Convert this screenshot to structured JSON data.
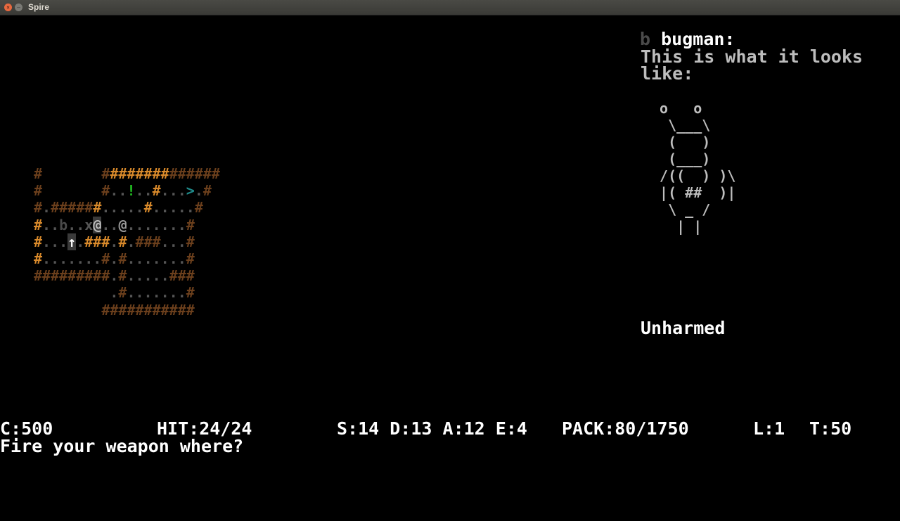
{
  "window": {
    "title": "Spire",
    "close_glyph": "×",
    "min_glyph": "–"
  },
  "map": {
    "rows": [
      [
        {
          "t": "#",
          "c": "#6b3f1c"
        },
        {
          "t": "       ",
          "c": "#000"
        },
        {
          "t": "#",
          "c": "#6b3f1c"
        },
        {
          "t": "#######",
          "c": "#d98a2b"
        },
        {
          "t": "######",
          "c": "#6b3f1c"
        }
      ],
      [
        {
          "t": "#",
          "c": "#6b3f1c"
        },
        {
          "t": "       ",
          "c": "#000"
        },
        {
          "t": "#",
          "c": "#6b3f1c"
        },
        {
          "t": "..",
          "c": "#555"
        },
        {
          "t": "!",
          "c": "#22c022"
        },
        {
          "t": "..",
          "c": "#555"
        },
        {
          "t": "#",
          "c": "#d98a2b"
        },
        {
          "t": "...",
          "c": "#555"
        },
        {
          "t": ">",
          "c": "#1f8a8a"
        },
        {
          "t": ".",
          "c": "#555"
        },
        {
          "t": "#",
          "c": "#6b3f1c"
        }
      ],
      [
        {
          "t": "#",
          "c": "#6b3f1c"
        },
        {
          "t": ".",
          "c": "#555"
        },
        {
          "t": "#####",
          "c": "#6b3f1c"
        },
        {
          "t": "#",
          "c": "#d98a2b"
        },
        {
          "t": ".....",
          "c": "#555"
        },
        {
          "t": "#",
          "c": "#d98a2b"
        },
        {
          "t": ".....",
          "c": "#555"
        },
        {
          "t": "#",
          "c": "#6b3f1c"
        }
      ],
      [
        {
          "t": "#",
          "c": "#d98a2b"
        },
        {
          "t": "..",
          "c": "#555"
        },
        {
          "t": "b",
          "c": "#4a4a4a"
        },
        {
          "t": "..",
          "c": "#555"
        },
        {
          "t": "x",
          "c": "#555"
        },
        {
          "t": "@",
          "c": "#bdbdbd",
          "hl": true
        },
        {
          "t": "..",
          "c": "#555"
        },
        {
          "t": "@",
          "c": "#9a9a9a"
        },
        {
          "t": ".......",
          "c": "#555"
        },
        {
          "t": "#",
          "c": "#6b3f1c"
        }
      ],
      [
        {
          "t": "#",
          "c": "#d98a2b"
        },
        {
          "t": "...",
          "c": "#555"
        },
        {
          "t": "↑",
          "c": "#ffffff",
          "hl": true
        },
        {
          "t": ".",
          "c": "#555"
        },
        {
          "t": "###",
          "c": "#d98a2b"
        },
        {
          "t": ".",
          "c": "#555"
        },
        {
          "t": "#",
          "c": "#d98a2b"
        },
        {
          "t": ".",
          "c": "#555"
        },
        {
          "t": "###",
          "c": "#6b3f1c"
        },
        {
          "t": "...",
          "c": "#555"
        },
        {
          "t": "#",
          "c": "#6b3f1c"
        }
      ],
      [
        {
          "t": "#",
          "c": "#d98a2b"
        },
        {
          "t": ".......",
          "c": "#555"
        },
        {
          "t": "#",
          "c": "#6b3f1c"
        },
        {
          "t": ".",
          "c": "#555"
        },
        {
          "t": "#",
          "c": "#6b3f1c"
        },
        {
          "t": ".......",
          "c": "#555"
        },
        {
          "t": "#",
          "c": "#6b3f1c"
        }
      ],
      [
        {
          "t": "#########",
          "c": "#6b3f1c"
        },
        {
          "t": ".",
          "c": "#555"
        },
        {
          "t": "#",
          "c": "#6b3f1c"
        },
        {
          "t": ".....",
          "c": "#555"
        },
        {
          "t": "###",
          "c": "#6b3f1c"
        }
      ],
      [
        {
          "t": "         ",
          "c": "#000"
        },
        {
          "t": ".",
          "c": "#555"
        },
        {
          "t": "#",
          "c": "#6b3f1c"
        },
        {
          "t": ".......",
          "c": "#555"
        },
        {
          "t": "#",
          "c": "#6b3f1c"
        }
      ],
      [
        {
          "t": "        ",
          "c": "#000"
        },
        {
          "t": "##########",
          "c": "#6b3f1c"
        },
        {
          "t": "#",
          "c": "#6b3f1c"
        }
      ]
    ]
  },
  "monster": {
    "glyph": "b",
    "name": "bugman:",
    "description": "This is what it looks like:",
    "art": " o   o\n  \\___\\\n  (   )\n  (___)\n /((  ) )\\\n |( ##  )|\n  \\ _ /\n   | |",
    "health": "Unharmed"
  },
  "status": {
    "coins": "C:500",
    "hit": "HIT:24/24",
    "stats": "S:14 D:13 A:12 E:4",
    "pack": "PACK:80/1750",
    "level": "L:1",
    "turn": "T:50"
  },
  "prompt": "Fire your weapon where?"
}
